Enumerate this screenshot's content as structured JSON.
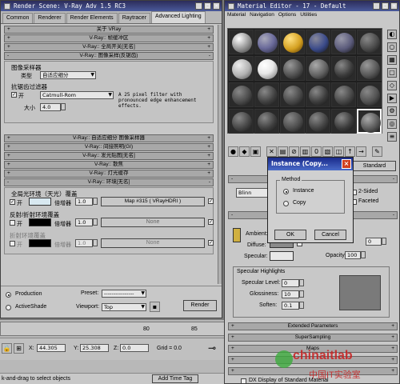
{
  "render": {
    "title": "Render Scene: V-Ray Adv 1.5 RC3",
    "tabs": [
      "Common",
      "Renderer",
      "Render Elements",
      "Raytracer",
      "Advanced Lighting"
    ],
    "rollouts_top": [
      "关于 VRay",
      "V-Ray:: 帧缓冲区",
      "V-Ray:: 全局开关[无名]",
      "V-Ray:: 图像采样(反锯齿)"
    ],
    "image_sampler": {
      "group": "图像采样器",
      "type_label": "类型",
      "type_value": "自适应细分"
    },
    "aa_filter": {
      "group": "抗锯齿过滤器",
      "on": "开",
      "filter": "Catmull-Rom",
      "desc": "A 25 pixel filter with pronounced edge enhancement effects.",
      "size_label": "大小",
      "size_value": "4.0"
    },
    "rollouts_mid": [
      "V-Ray:: 自适应细分 图像采样器",
      "V-Ray:: 间接照明(GI)",
      "V-Ray:: 发光贴图[无名]",
      "V-Ray:: 散焦",
      "V-Ray:: 灯光缓存",
      "V-Ray:: 环境[无名]"
    ],
    "environment": {
      "gi_group": "全局光环境（天光）覆盖",
      "gi_on": "开",
      "gi_mult_label": "倍增器",
      "gi_mult": "1.0",
      "gi_map": "Map #315  ( VRayHDRI )",
      "refl_group": "反射/折射环境覆盖",
      "refl_on": "开",
      "refl_mult_label": "倍增器",
      "refl_mult": "1.0",
      "refl_map": "None",
      "refr_group": "折射环境覆盖",
      "refr_on": "开",
      "refr_mult_label": "倍增器",
      "refr_mult": "1.0",
      "refr_map": "None"
    },
    "bottom": {
      "production": "Production",
      "activeshade": "ActiveShade",
      "preset_label": "Preset:",
      "preset_value": "----------------",
      "viewport_label": "Viewport:",
      "viewport_value": "Top",
      "render_btn": "Render"
    }
  },
  "status": {
    "x_label": "X:",
    "x_value": "44.305",
    "y_label": "Y:",
    "y_value": "25.308",
    "z_label": "Z:",
    "z_value": "0.0",
    "grid": "Grid = 0.0",
    "hint": "k-and-drag to select objects",
    "time_tag": "Add Time Tag",
    "ruler": [
      "80",
      "85"
    ]
  },
  "material": {
    "title": "Material Editor - 17 - Default",
    "menu": [
      "Material",
      "Navigation",
      "Options",
      "Utilities"
    ],
    "spheres": [
      "#d8d8d8",
      "#6a6a9a",
      "#d4a020",
      "#3a4a8a",
      "#5a5a7a",
      "#4a4a4a",
      "#b0b0b0",
      "#e8e8e8",
      "#505050",
      "#606060",
      "#3a3a3a",
      "#555555",
      "#4a4a4a",
      "#404040",
      "#484848",
      "#3c3c3c",
      "#464646",
      "#505050",
      "#444444",
      "#3e3e3e",
      "#4c4c4c",
      "#424242",
      "#3a3a3a",
      "#585858"
    ],
    "material_name": "Standard",
    "shader": "Blinn",
    "two_sided": "2-Sided",
    "faceted": "Faceted",
    "ambient_label": "Ambient:",
    "diffuse_label": "Diffuse:",
    "specular_label": "Specular:",
    "self_illum_value": "0",
    "opacity_label": "Opacity:",
    "opacity_value": "100",
    "spec_group": "Specular Highlights",
    "spec_level_label": "Specular Level:",
    "spec_level_value": "0",
    "gloss_label": "Glossiness:",
    "gloss_value": "10",
    "soften_label": "Soften:",
    "soften_value": "0.1",
    "rollouts": [
      "Extended Parameters",
      "SuperSampling",
      "Maps",
      "DX Display of Standard Material"
    ]
  },
  "dialog": {
    "title": "Instance  (Copy...",
    "group": "Method",
    "instance": "Instance",
    "copy": "Copy",
    "ok": "OK",
    "cancel": "Cancel"
  },
  "watermark": {
    "brand": "chinaitlab",
    "sub": "中国IT实验室"
  },
  "colors": {
    "titlebar": "#3a4a8a",
    "dialog_title": "#2a3a9a",
    "close_btn": "#d04020",
    "watermark": "#d02020"
  }
}
